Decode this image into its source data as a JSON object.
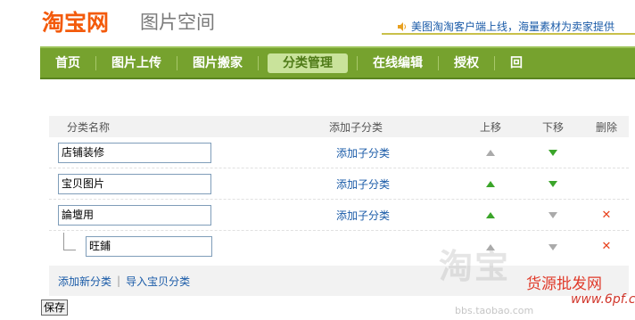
{
  "header": {
    "logo_text": "淘宝网",
    "site_title": "图片空间",
    "notice": "美图淘淘客户端上线，海量素材为卖家提供"
  },
  "nav": {
    "items": [
      {
        "label": "首页"
      },
      {
        "label": "图片上传"
      },
      {
        "label": "图片搬家"
      },
      {
        "label": "分类管理",
        "active": true
      },
      {
        "label": "在线编辑"
      },
      {
        "label": "授权"
      },
      {
        "label": "回"
      }
    ]
  },
  "table": {
    "headers": {
      "name": "分类名称",
      "add_child": "添加子分类",
      "move_up": "上移",
      "move_down": "下移",
      "delete": "删除"
    },
    "rows": [
      {
        "name": "店铺装修",
        "add_child": "添加子分类",
        "up_enabled": false,
        "down_enabled": true,
        "deletable": false
      },
      {
        "name": "宝贝图片",
        "add_child": "添加子分类",
        "up_enabled": true,
        "down_enabled": true,
        "deletable": false
      },
      {
        "name": "論壇用",
        "add_child": "添加子分类",
        "up_enabled": true,
        "down_enabled": false,
        "deletable": true
      },
      {
        "name": "旺鋪",
        "child": true,
        "up_enabled": false,
        "down_enabled": false,
        "deletable": true
      }
    ],
    "delete_symbol": "✕"
  },
  "footer": {
    "add_category": "添加新分类",
    "separator": "|",
    "import_category": "导入宝贝分类",
    "save_label": "保存"
  },
  "watermark": {
    "big_text": "淘宝",
    "red_text": "货源批发网",
    "url_text": "www.6pf.cn",
    "bbs_text": "bbs.taobao.com"
  },
  "colors": {
    "logo": "#f35a0b",
    "nav_bg": "#76a22e",
    "link": "#1a5ba8",
    "arrow_enabled": "#3ba52a",
    "arrow_disabled": "#aaaaaa",
    "delete": "#e8421d"
  }
}
